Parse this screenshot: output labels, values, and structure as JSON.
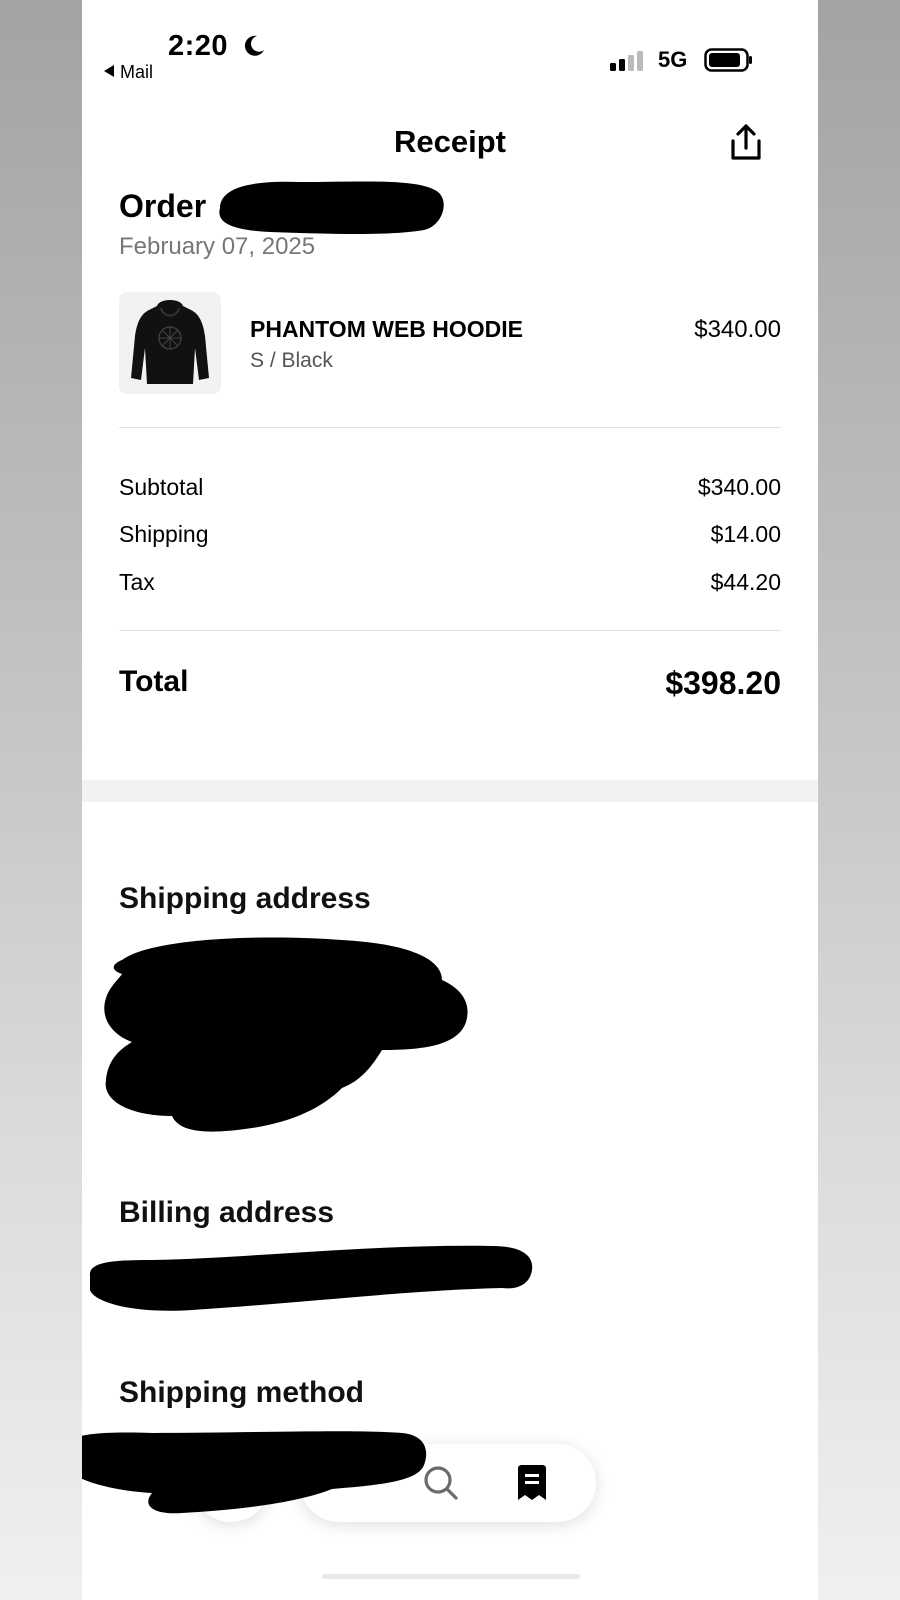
{
  "status_bar": {
    "time": "2:20",
    "back_app": "Mail",
    "network": "5G"
  },
  "header": {
    "title": "Receipt"
  },
  "order": {
    "label": "Order",
    "date": "February 07, 2025"
  },
  "product": {
    "name": "PHANTOM WEB HOODIE",
    "variant": "S / Black",
    "price": "$340.00"
  },
  "summary": {
    "subtotal_label": "Subtotal",
    "subtotal_value": "$340.00",
    "shipping_label": "Shipping",
    "shipping_value": "$14.00",
    "tax_label": "Tax",
    "tax_value": "$44.20",
    "total_label": "Total",
    "total_value": "$398.20"
  },
  "sections": {
    "shipping_address": "Shipping address",
    "billing_address": "Billing address",
    "shipping_method": "Shipping method"
  },
  "colors": {
    "text": "#000000",
    "muted": "#777777",
    "divider": "#e2e2e2",
    "section_gap": "#f1f2f4"
  },
  "icons": [
    "moon-icon",
    "signal-icon",
    "battery-icon",
    "share-icon",
    "search-icon",
    "receipt-icon"
  ]
}
